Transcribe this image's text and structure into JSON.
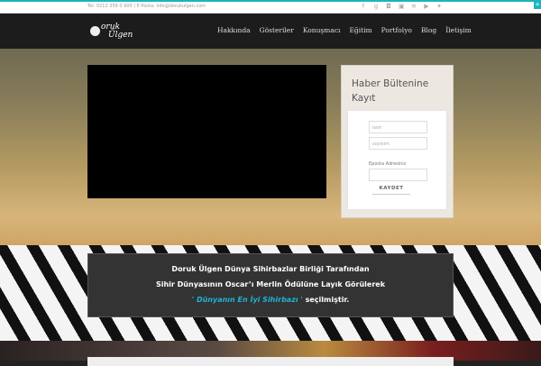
{
  "topbar": {
    "contact": "Tel: 0212 356 0 900 | E-Posta: info@dorukulgen.com",
    "social": [
      {
        "icon": "facebook-icon",
        "glyph": "f"
      },
      {
        "icon": "google-plus-icon",
        "glyph": "g"
      },
      {
        "icon": "instagram-icon",
        "glyph": "◘"
      },
      {
        "icon": "linkedin-icon",
        "glyph": "▣"
      },
      {
        "icon": "rss-icon",
        "glyph": "≋"
      },
      {
        "icon": "youtube-icon",
        "glyph": "▶"
      },
      {
        "icon": "twitter-icon",
        "glyph": "✦"
      }
    ],
    "corner": "+"
  },
  "logo": {
    "line1": "oruk",
    "line2": "Ülgen"
  },
  "nav": [
    "Hakkında",
    "Gösteriler",
    "Konuşmacı",
    "Eğitim",
    "Portfolyo",
    "Blog",
    "İletişim"
  ],
  "newsletter": {
    "title": "Haber Bültenine Kayıt",
    "name_placeholder": "isim",
    "surname_placeholder": "soyisim",
    "email_label": "Eposta Adresiniz",
    "submit": "KAYDET"
  },
  "banner": {
    "line1": "Doruk Ülgen Dünya Sihirbazlar Birliği Tarafından",
    "line2": "Sihir Dünyasının Oscar’ı Merlin Ödülüne Layık Görülerek",
    "highlight": "' Dünyanın En İyi Sihirbazı '",
    "line3_suffix": " seçilmiştir."
  },
  "colors": {
    "accent": "#1bb5bd",
    "highlight": "#1fb3d6"
  }
}
